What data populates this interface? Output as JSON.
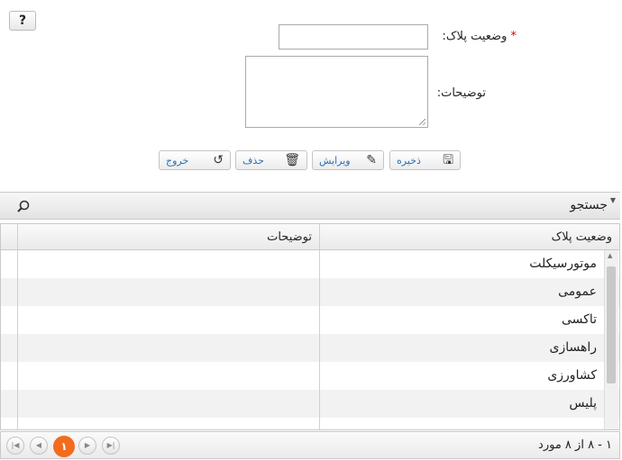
{
  "help": {
    "label": "?"
  },
  "form": {
    "plate_status_label": "وضعیت پلاک:",
    "required_mark": "*",
    "plate_status_value": "",
    "description_label": "توضیحات:",
    "description_value": ""
  },
  "buttons": {
    "save": "ذخیره",
    "edit": "ویرایش",
    "delete": "حذف",
    "exit": "خروج"
  },
  "search": {
    "label": "جستجو"
  },
  "table": {
    "columns": [
      "وضعیت پلاک",
      "توضیحات"
    ],
    "rows": [
      [
        "موتورسیکلت",
        ""
      ],
      [
        "عمومی",
        ""
      ],
      [
        "تاکسی",
        ""
      ],
      [
        "راهسازی",
        ""
      ],
      [
        "کشاورزی",
        ""
      ],
      [
        "پلیس",
        ""
      ]
    ]
  },
  "pager": {
    "current_page": "۱",
    "summary": "۱ - ۸ از ۸ مورد"
  }
}
